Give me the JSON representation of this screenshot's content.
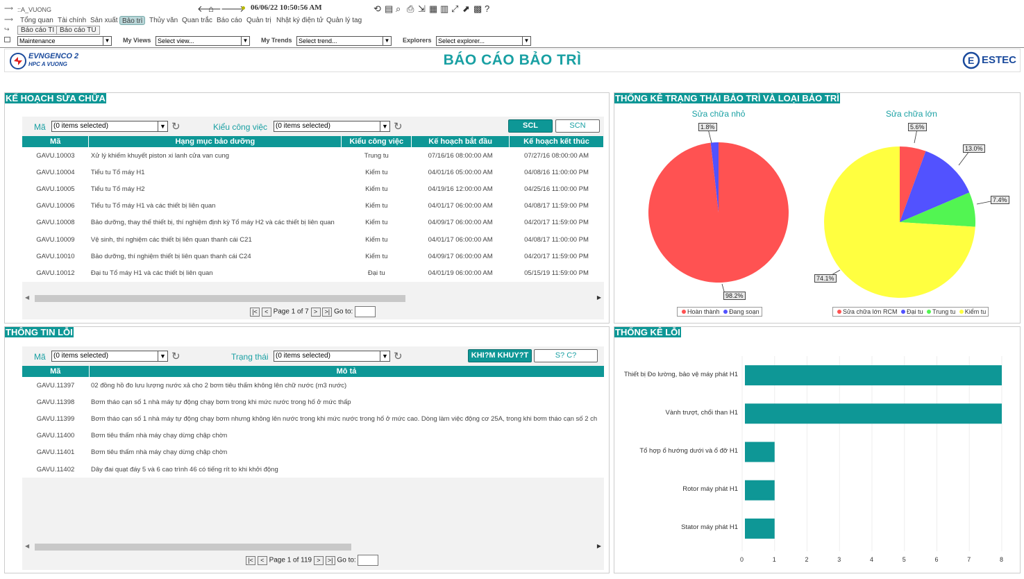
{
  "topbar": {
    "site": "::A_VUONG",
    "datetime": "06/06/22 10:50:56 AM",
    "tabs": [
      "Tổng quan",
      "Tài chính",
      "Sản xuất",
      "Bảo trì",
      "Thủy văn",
      "Quan trắc",
      "Báo cáo",
      "Quản trị",
      "Nhật ký điện tử",
      "Quản lý tag"
    ],
    "active_tab": 3,
    "subtabs": [
      "Báo cáo TI",
      "Báo cáo TU"
    ],
    "view_select": "Maintenance",
    "my_views_label": "My Views",
    "my_views_value": "Select view...",
    "my_trends_label": "My Trends",
    "my_trends_value": "Select trend...",
    "explorers_label": "Explorers",
    "explorers_value": "Select explorer..."
  },
  "header": {
    "logo_main": "EVNGENCO 2",
    "logo_sub": "HPC A VUONG",
    "title": "BÁO CÁO BẢO TRÌ",
    "logo_right": "ESTEC"
  },
  "plan": {
    "title": "KẾ HOẠCH SỬA CHỮA",
    "filter_ma_label": "Mã",
    "filter_ma_value": "(0 items selected)",
    "filter_kieu_label": "Kiểu công việc",
    "filter_kieu_value": "(0 items selected)",
    "btn_scl": "SCL",
    "btn_scn": "SCN",
    "columns": [
      "Mã",
      "Hạng mục bảo dưỡng",
      "Kiểu công việc",
      "Kế hoạch bắt đầu",
      "Kế hoạch kết thúc"
    ],
    "rows": [
      [
        "GAVU.10003",
        "Xử lý khiếm khuyết piston xi lanh cửa van cung",
        "Trung tu",
        "07/16/16 08:00:00 AM",
        "07/27/16 08:00:00 AM"
      ],
      [
        "GAVU.10004",
        "Tiểu tu Tổ máy H1",
        "Kiểm tu",
        "04/01/16 05:00:00 AM",
        "04/08/16 11:00:00 PM"
      ],
      [
        "GAVU.10005",
        "Tiểu tu Tổ máy H2",
        "Kiểm tu",
        "04/19/16 12:00:00 AM",
        "04/25/16 11:00:00 PM"
      ],
      [
        "GAVU.10006",
        "Tiểu tu Tổ máy H1 và các thiết bị liên quan",
        "Kiểm tu",
        "04/01/17 06:00:00 AM",
        "04/08/17 11:59:00 PM"
      ],
      [
        "GAVU.10008",
        "Bảo dưỡng, thay thế thiết bị, thí nghiệm định kỳ Tổ máy H2 và các thiết bị liên quan",
        "Kiểm tu",
        "04/09/17 06:00:00 AM",
        "04/20/17 11:59:00 PM"
      ],
      [
        "GAVU.10009",
        "Vệ sinh, thí nghiệm các thiết bị liên quan thanh cái C21",
        "Kiểm tu",
        "04/01/17 06:00:00 AM",
        "04/08/17 11:00:00 PM"
      ],
      [
        "GAVU.10010",
        "Bảo dưỡng, thí nghiệm thiết bị liên quan thanh cái C24",
        "Kiểm tu",
        "04/09/17 06:00:00 AM",
        "04/20/17 11:59:00 PM"
      ],
      [
        "GAVU.10012",
        "Đại tu Tổ máy H1 và các thiết bị liên quan",
        "Đại tu",
        "04/01/19 06:00:00 AM",
        "05/15/19 11:59:00 PM"
      ]
    ],
    "pager_text": "Page 1 of 7",
    "goto_label": "Go to:"
  },
  "faults": {
    "title": "THÔNG TIN LỖI",
    "filter_ma_label": "Mã",
    "filter_ma_value": "(0 items selected)",
    "filter_status_label": "Trạng thái",
    "filter_status_value": "(0 items selected)",
    "btn_1": "KHI?M KHUY?T",
    "btn_2": "S? C?",
    "columns": [
      "Mã",
      "Mô tả"
    ],
    "rows": [
      [
        "GAVU.11397",
        "02 đồng hồ đo lưu lượng nước xả cho 2 bơm tiêu thấm không lên chữ nước (m3 nước)"
      ],
      [
        "GAVU.11398",
        "Bơm tháo cạn số 1 nhà máy tự động chạy bơm trong khi mức nước trong hố ở mức thấp"
      ],
      [
        "GAVU.11399",
        "Bơm tháo cạn số 1 nhà máy tự động chạy bơm nhưng không lên nước trong khi mức nước trong hố ở mức cao. Dòng làm việc động cơ 25A, trong khi bơm tháo cạn số 2 ch"
      ],
      [
        "GAVU.11400",
        "Bơm tiêu thấm nhà máy chạy dừng chập chờn"
      ],
      [
        "GAVU.11401",
        "Bơm tiêu thấm nhà máy chạy dừng chập chờn"
      ],
      [
        "GAVU.11402",
        "Dây đai quạt đáy 5 và 6 cao trình 46 có tiếng rít to khi khởi động"
      ]
    ],
    "pager_text": "Page 1 of 119",
    "goto_label": "Go to:"
  },
  "status_stats": {
    "title": "THỐNG KÊ TRẠNG THÁI BẢO TRÌ VÀ LOẠI BẢO TRÌ",
    "pie1_title": "Sửa chữa nhỏ",
    "pie1_labels": [
      "1.8%",
      "98.2%"
    ],
    "pie1_legend": [
      "Hoàn thành",
      "Đang soạn"
    ],
    "pie2_title": "Sửa chữa lớn",
    "pie2_labels": [
      "5.6%",
      "13.0%",
      "7.4%",
      "74.1%"
    ],
    "pie2_legend": [
      "Sửa chữa lớn RCM",
      "Đại tu",
      "Trung tu",
      "Kiểm tu"
    ],
    "colors": {
      "red": "#ff5252",
      "blue": "#5252ff",
      "green": "#52f552",
      "yellow": "#ffff40"
    }
  },
  "fault_stats": {
    "title": "THỐNG KÊ LỖI"
  },
  "chart_data": [
    {
      "type": "pie",
      "title": "Sửa chữa nhỏ",
      "labels": [
        "Hoàn thành",
        "Đang soạn"
      ],
      "values": [
        98.2,
        1.8
      ],
      "colors": [
        "#ff5252",
        "#5252ff"
      ],
      "legend": "bottom"
    },
    {
      "type": "pie",
      "title": "Sửa chữa lớn",
      "labels": [
        "Sửa chữa lớn RCM",
        "Đại tu",
        "Trung tu",
        "Kiểm tu"
      ],
      "values": [
        5.6,
        13.0,
        7.4,
        74.1
      ],
      "colors": [
        "#ff5252",
        "#5252ff",
        "#52f552",
        "#ffff40"
      ],
      "legend": "bottom"
    },
    {
      "type": "bar",
      "orientation": "horizontal",
      "categories": [
        "Thiết bị Đo lường, bảo vệ máy phát H1",
        "Vành trượt, chổi than H1",
        "Tổ hợp ổ hướng dưới và ổ đỡ H1",
        "Rotor máy phát H1",
        "Stator máy phát H1"
      ],
      "values": [
        8,
        8,
        1,
        1,
        1
      ],
      "xlim": [
        0,
        8
      ],
      "xticks": [
        "0",
        "1",
        "2",
        "3",
        "4",
        "5",
        "6",
        "7",
        "8"
      ],
      "color": "#0e9796",
      "grid": true
    }
  ]
}
